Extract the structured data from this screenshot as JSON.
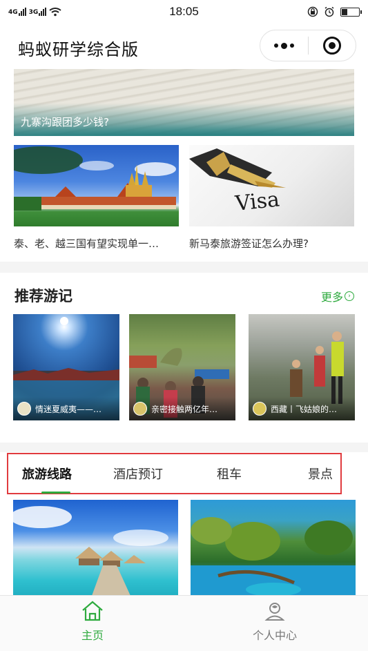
{
  "status_bar": {
    "left": [
      "4G",
      "3G"
    ],
    "time": "18:05",
    "battery_level": 0.3
  },
  "nav": {
    "title": "蚂蚁研学综合版",
    "menu_icon": "more-dots-icon",
    "close_icon": "target-circle-icon"
  },
  "articles": {
    "hero_caption": "九寨沟跟团多少钱?",
    "items": [
      {
        "caption": "泰、老、越三国有望实现单一…",
        "image": "temple-image"
      },
      {
        "caption": "新马泰旅游签证怎么办理?",
        "image": "visa-pen-image"
      }
    ]
  },
  "notes": {
    "title": "推荐游记",
    "more_label": "更多",
    "items": [
      {
        "caption": "情迷夏威夷——…",
        "image": "lake-sun-image"
      },
      {
        "caption": "亲密接触两亿年…",
        "image": "dinosaur-park-image"
      },
      {
        "caption": "西藏丨飞姑娘的…",
        "image": "hikers-image"
      }
    ]
  },
  "tabs": {
    "items": [
      "旅游线路",
      "酒店预订",
      "租车",
      "景点"
    ],
    "active_index": 0
  },
  "routes": [
    "maldives-image",
    "jiuzhai-lake-image"
  ],
  "tabbar": {
    "items": [
      {
        "label": "主页",
        "icon": "home-icon",
        "active": true
      },
      {
        "label": "个人中心",
        "icon": "user-icon",
        "active": false
      }
    ]
  },
  "colors": {
    "accent": "#2eaa3e",
    "highlight_border": "#e03a3e"
  }
}
